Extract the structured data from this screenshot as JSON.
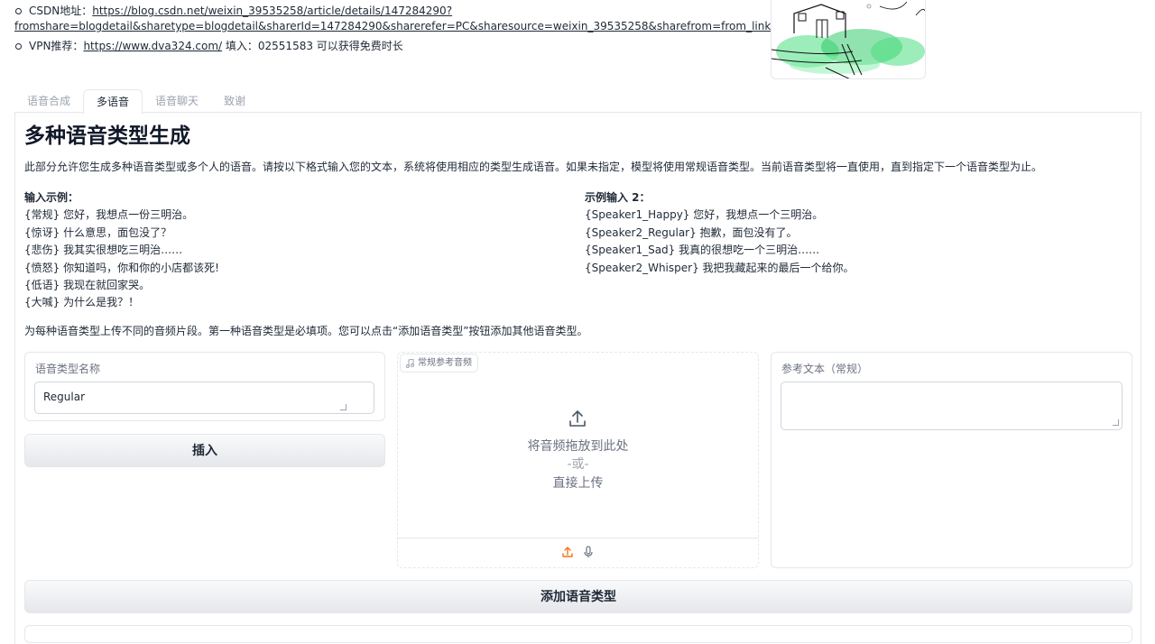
{
  "links": {
    "csdn_label": "CSDN地址：",
    "csdn_url_line1": "https://blog.csdn.net/weixin_39535258/article/details/147284290?",
    "csdn_url_line2": "fromshare=blogdetail&sharetype=blogdetail&sharerId=147284290&sharerefer=PC&sharesource=weixin_39535258&sharefrom=from_link",
    "vpn_label": "VPN推荐：",
    "vpn_url": "https://www.dva324.com/",
    "vpn_suffix": " 填入：02551583 可以获得免费时长"
  },
  "tabs": [
    {
      "label": "语音合成",
      "active": false
    },
    {
      "label": "多语音",
      "active": true
    },
    {
      "label": "语音聊天",
      "active": false
    },
    {
      "label": "致谢",
      "active": false
    }
  ],
  "main": {
    "title": "多种语音类型生成",
    "intro": "此部分允许您生成多种语音类型或多个人的语音。请按以下格式输入您的文本，系统将使用相应的类型生成语音。如果未指定，模型将使用常规语音类型。当前语音类型将一直使用，直到指定下一个语音类型为止。",
    "example1": {
      "heading": "输入示例：",
      "lines": [
        "{常规} 您好，我想点一份三明治。",
        "{惊讶} 什么意思，面包没了？",
        "{悲伤} 我其实很想吃三明治……",
        "{愤怒} 你知道吗，你和你的小店都该死!",
        "{低语} 我现在就回家哭。",
        "{大喊} 为什么是我？！"
      ]
    },
    "example2": {
      "heading": "示例输入 2：",
      "lines": [
        "{Speaker1_Happy} 您好，我想点一个三明治。",
        "{Speaker2_Regular} 抱歉，面包没有了。",
        "{Speaker1_Sad} 我真的很想吃一个三明治……",
        "{Speaker2_Whisper} 我把我藏起来的最后一个给你。"
      ]
    },
    "note": "为每种语音类型上传不同的音频片段。第一种语音类型是必填项。您可以点击“添加语音类型”按钮添加其他语音类型。"
  },
  "voice_form": {
    "name_label": "语音类型名称",
    "name_value": "Regular",
    "insert_button": "插入",
    "audio_label": "常规参考音频",
    "drop_text": "将音频拖放到此处",
    "or_text": "-或-",
    "upload_text": "直接上传",
    "ref_label": "参考文本（常规）",
    "ref_value": "",
    "add_button": "添加语音类型"
  },
  "colors": {
    "accent": "#f97316",
    "border": "#e5e7eb",
    "muted": "#6b7280"
  }
}
